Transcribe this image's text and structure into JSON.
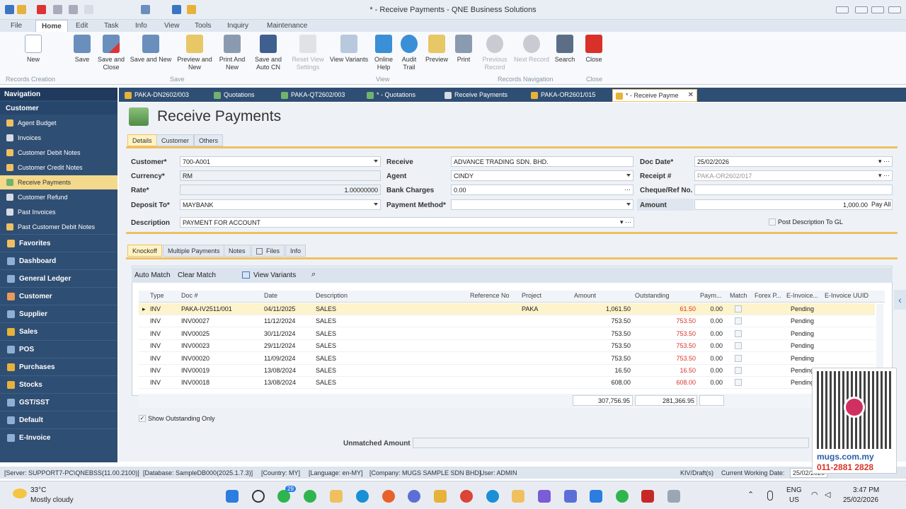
{
  "window": {
    "title": "* - Receive Payments - QNE Business Solutions"
  },
  "menu": [
    "File",
    "Home",
    "Edit",
    "Task",
    "Info",
    "View",
    "Tools",
    "Inquiry",
    "Maintenance"
  ],
  "ribbon": {
    "buttons": [
      "New",
      "Save",
      "Save and Close",
      "Save and New",
      "Preview and New",
      "Print And New",
      "Save and Auto CN",
      "Reset View Settings",
      "View Variants",
      "Online Help",
      "Audit Trail",
      "Preview",
      "Print",
      "Previous Record",
      "Next Record",
      "Search",
      "Close"
    ],
    "groups": [
      "Records Creation",
      "Save",
      "View",
      "Records Navigation",
      "Close"
    ]
  },
  "nav": {
    "header": "Navigation",
    "section": "Customer",
    "items": [
      "Agent Budget",
      "Invoices",
      "Customer Debit Notes",
      "Customer Credit Notes",
      "Receive Payments",
      "Customer Refund",
      "Past Invoices",
      "Past Customer Debit Notes"
    ],
    "categories": [
      "Favorites",
      "Dashboard",
      "General Ledger",
      "Customer",
      "Supplier",
      "Sales",
      "POS",
      "Purchases",
      "Stocks",
      "GST/SST",
      "Default",
      "E-Invoice"
    ]
  },
  "tabs": [
    "PAKA-DN2602/003",
    "Quotations",
    "PAKA-QT2602/003",
    "* - Quotations",
    "Receive Payments",
    "PAKA-OR2601/015",
    "* - Receive Payme"
  ],
  "page": {
    "title": "Receive Payments",
    "subtabs": [
      "Details",
      "Customer",
      "Others"
    ],
    "fields": {
      "customer_label": "Customer*",
      "customer": "700-A001",
      "currency_label": "Currency*",
      "currency": "RM",
      "rate_label": "Rate*",
      "rate": "1.00000000",
      "deposit_label": "Deposit To*",
      "deposit": "MAYBANK",
      "description_label": "Description",
      "description": "PAYMENT FOR ACCOUNT",
      "receive_label": "Receive",
      "receive": "ADVANCE TRADING SDN. BHD.",
      "agent_label": "Agent",
      "agent": "CINDY",
      "bank_label": "Bank Charges",
      "bank": "0.00",
      "paymethod_label": "Payment Method*",
      "paymethod": "",
      "docdate_label": "Doc Date*",
      "docdate": "25/02/2026",
      "receipt_label": "Receipt #",
      "receipt": "PAKA-OR2602/017",
      "cheque_label": "Cheque/Ref No.",
      "cheque": "",
      "amount_label": "Amount",
      "amount": "1,000.00",
      "payall": "Pay All",
      "postdesc": "Post Description To GL"
    },
    "lower_tabs": [
      "Knockoff",
      "Multiple Payments",
      "Notes",
      "Files",
      "Info"
    ],
    "toolbar": {
      "auto": "Auto Match",
      "clear": "Clear Match",
      "variants": "View Variants"
    },
    "columns": [
      "Type",
      "Doc #",
      "Date",
      "Description",
      "Reference No",
      "Project",
      "Amount",
      "Outstanding",
      "Paym...",
      "Match",
      "Forex P...",
      "E-Invoice...",
      "E-Invoice UUID"
    ],
    "rows": [
      {
        "type": "INV",
        "doc": "PAKA-IV2511/001",
        "date": "04/11/2025",
        "desc": "SALES",
        "project": "PAKA",
        "amount": "1,061.50",
        "outstanding": "61.50",
        "pay": "0.00",
        "einv": "Pending"
      },
      {
        "type": "INV",
        "doc": "INV00027",
        "date": "11/12/2024",
        "desc": "SALES",
        "project": "",
        "amount": "753.50",
        "outstanding": "753.50",
        "pay": "0.00",
        "einv": "Pending"
      },
      {
        "type": "INV",
        "doc": "INV00025",
        "date": "30/11/2024",
        "desc": "SALES",
        "project": "",
        "amount": "753.50",
        "outstanding": "753.50",
        "pay": "0.00",
        "einv": "Pending"
      },
      {
        "type": "INV",
        "doc": "INV00023",
        "date": "29/11/2024",
        "desc": "SALES",
        "project": "",
        "amount": "753.50",
        "outstanding": "753.50",
        "pay": "0.00",
        "einv": "Pending"
      },
      {
        "type": "INV",
        "doc": "INV00020",
        "date": "11/09/2024",
        "desc": "SALES",
        "project": "",
        "amount": "753.50",
        "outstanding": "753.50",
        "pay": "0.00",
        "einv": "Pending"
      },
      {
        "type": "INV",
        "doc": "INV00019",
        "date": "13/08/2024",
        "desc": "SALES",
        "project": "",
        "amount": "16.50",
        "outstanding": "16.50",
        "pay": "0.00",
        "einv": "Pending"
      },
      {
        "type": "INV",
        "doc": "INV00018",
        "date": "13/08/2024",
        "desc": "SALES",
        "project": "",
        "amount": "608.00",
        "outstanding": "608.00",
        "pay": "0.00",
        "einv": "Pending"
      }
    ],
    "totals": {
      "amount": "307,756.95",
      "outstanding": "281,366.95"
    },
    "show_outstanding": "Show Outstanding Only",
    "unmatched": "Unmatched Amount"
  },
  "status": {
    "server": "[Server: SUPPORT7-PC\\QNEBSS(11.00.2100)]",
    "database": "[Database: SampleDB000(2025.1.7.3)]",
    "country": "[Country: MY]",
    "language": "[Language: en-MY]",
    "company": "[Company: MUGS SAMPLE SDN BHD]",
    "user": "User: ADMIN",
    "kiv": "KIV/Draft(s)",
    "cwd": "Current Working Date:",
    "cwd_value": "25/02/2026"
  },
  "taskbar": {
    "temp": "33°C",
    "weather": "Mostly cloudy",
    "lang": "ENG",
    "region": "US",
    "time": "3:47 PM",
    "date": "25/02/2026",
    "badge": "29"
  },
  "watermark": {
    "site": "mugs.com.my",
    "phone": "011-2881 2828"
  },
  "colors": {
    "nav": "#2f4e73",
    "accent": "#f0c060",
    "red": "#d8342b"
  }
}
